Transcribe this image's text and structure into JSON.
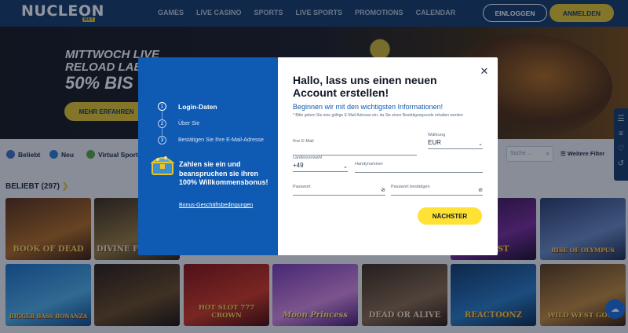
{
  "header": {
    "logo": "NUCLEON",
    "logo_badge": "BET",
    "nav": [
      "GAMES",
      "LIVE CASINO",
      "SPORTS",
      "LIVE SPORTS",
      "PROMOTIONS",
      "CALENDAR"
    ],
    "login_label": "EINLOGGEN",
    "register_label": "ANMELDEN"
  },
  "hero": {
    "line1": "MITTWOCH LIVE",
    "line2": "RELOAD LAB",
    "line3": "50% BIS",
    "button": "MEHR ERFAHREN"
  },
  "filters": {
    "items": [
      "Beliebt",
      "Neu",
      "Virtual Sports"
    ],
    "search_placeholder": "Suche ...",
    "more_filters": "Weitere Filter"
  },
  "games": {
    "section_title": "BELIEBT (297)",
    "row1": [
      "BOOK OF DEAD",
      "DIVINE FORTUNE",
      "",
      "",
      "",
      "BURST",
      "RISE OF OLYMPUS"
    ],
    "row2": [
      "BIGGER BASS BONANZA",
      "",
      "HOT SLOT 777 CROWN",
      "Moon Princess",
      "DEAD OR ALIVE",
      "REACTOONZ",
      "WILD WEST GOLD"
    ]
  },
  "modal": {
    "steps": [
      {
        "num": "1",
        "label": "Login-Daten"
      },
      {
        "num": "2",
        "label": "Über Sie"
      },
      {
        "num": "3",
        "label": "Bestätigen Sie Ihre E-Mail-Adresse"
      }
    ],
    "bonus_text": "Zahlen sie ein und beanspruchen sie ihren 100% Willkommensbonus!",
    "bonus_link": "Bonus-Geschäftsbedingungen",
    "title": "Hallo, lass uns einen neuen Account erstellen!",
    "subtitle": "Beginnen wir mit den wichtigsten Informationen!",
    "note": "* Bitte geben Sie eine gültige E-Mail-Adresse ein, da Sie einen Bestätigungscode erhalten werden",
    "email_label": "Ihre E-Mail",
    "currency_label": "Währung",
    "currency_value": "EUR",
    "country_code_label": "Landesvorwahl",
    "country_code_value": "+49",
    "phone_label": "Handynummer",
    "password_label": "Passwort",
    "password_confirm_label": "Passwort bestätigen",
    "next_button": "NÄCHSTER"
  },
  "colors": {
    "brand_blue": "#0f5ab2",
    "header_bg": "#143a66",
    "accent_yellow": "#e6c52b",
    "button_yellow": "#ffe234"
  }
}
